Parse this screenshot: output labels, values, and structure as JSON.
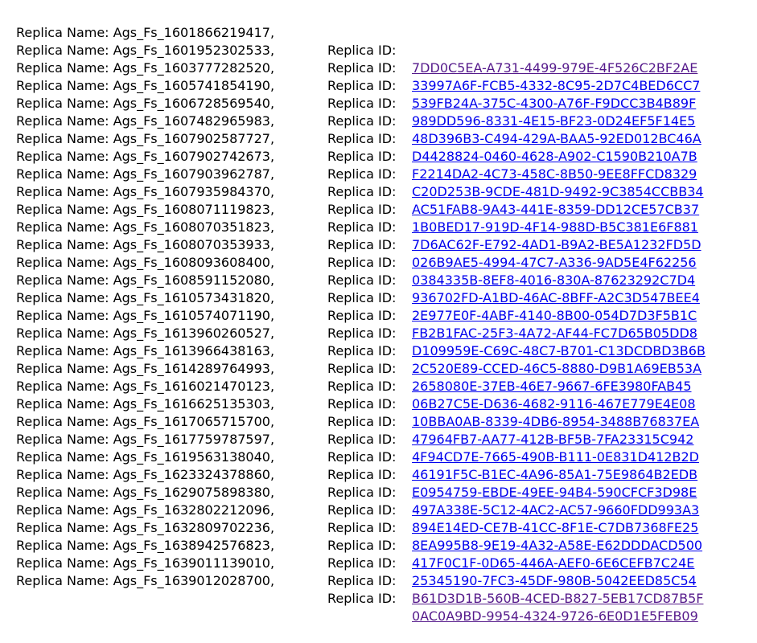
{
  "labels": {
    "name_prefix": "Replica Name: ",
    "id_prefix": "Replica ID: "
  },
  "colors": {
    "link": "#0000ee",
    "visited_link": "#551a8b",
    "text": "#000000"
  },
  "replicas": [
    {
      "name": "Ags_Fs_1601866219417,",
      "id": "7DD0C5EA-A731-4499-979E-4F526C2BF2AE",
      "visited": true
    },
    {
      "name": "Ags_Fs_1601952302533,",
      "id": "33997A6F-FCB5-4332-8C95-2D7C4BED6CC7",
      "visited": false
    },
    {
      "name": "Ags_Fs_1603777282520,",
      "id": "539FB24A-375C-4300-A76F-F9DCC3B4B89F",
      "visited": false
    },
    {
      "name": "Ags_Fs_1605741854190,",
      "id": "989DD596-8331-4E15-BF23-0D24EF5F14E5",
      "visited": false
    },
    {
      "name": "Ags_Fs_1606728569540,",
      "id": "48D396B3-C494-429A-BAA5-92ED012BC46A",
      "visited": false
    },
    {
      "name": "Ags_Fs_1607482965983,",
      "id": "D4428824-0460-4628-A902-C1590B210A7B",
      "visited": false
    },
    {
      "name": "Ags_Fs_1607902587727,",
      "id": "F2214DA2-4C73-458C-8B50-9EE8FFCD8329",
      "visited": false
    },
    {
      "name": "Ags_Fs_1607902742673,",
      "id": "C20D253B-9CDE-481D-9492-9C3854CCBB34",
      "visited": false
    },
    {
      "name": "Ags_Fs_1607903962787,",
      "id": "AC51FAB8-9A43-441E-8359-DD12CE57CB37",
      "visited": false
    },
    {
      "name": "Ags_Fs_1607935984370,",
      "id": "1B0BED17-919D-4F14-988D-B5C381E6F881",
      "visited": false
    },
    {
      "name": "Ags_Fs_1608071119823,",
      "id": "7D6AC62F-E792-4AD1-B9A2-BE5A1232FD5D",
      "visited": false
    },
    {
      "name": "Ags_Fs_1608070351823,",
      "id": "026B9AE5-4994-47C7-A336-9AD5E4F62256",
      "visited": false
    },
    {
      "name": "Ags_Fs_1608070353933,",
      "id": "0384335B-8EF8-4016-830A-87623292C7D4",
      "visited": false
    },
    {
      "name": "Ags_Fs_1608093608400,",
      "id": "936702FD-A1BD-46AC-8BFF-A2C3D547BEE4",
      "visited": false
    },
    {
      "name": "Ags_Fs_1608591152080,",
      "id": "2E977E0F-4ABF-4140-8B00-054D7D3F5B1C",
      "visited": false
    },
    {
      "name": "Ags_Fs_1610573431820,",
      "id": "FB2B1FAC-25F3-4A72-AF44-FC7D65B05DD8",
      "visited": false
    },
    {
      "name": "Ags_Fs_1610574071190,",
      "id": "D109959E-C69C-48C7-B701-C13DCDBD3B6B",
      "visited": false
    },
    {
      "name": "Ags_Fs_1613960260527,",
      "id": "2C520E89-CCED-46C5-8880-D9B1A69EB53A",
      "visited": false
    },
    {
      "name": "Ags_Fs_1613966438163,",
      "id": "2658080E-37EB-46E7-9667-6FE3980FAB45",
      "visited": false
    },
    {
      "name": "Ags_Fs_1614289764993,",
      "id": "06B27C5E-D636-4682-9116-467E779E4E08",
      "visited": false
    },
    {
      "name": "Ags_Fs_1616021470123,",
      "id": "10BBA0AB-8339-4DB6-8954-3488B76837EA",
      "visited": false
    },
    {
      "name": "Ags_Fs_1616625135303,",
      "id": "47964FB7-AA77-412B-BF5B-7FA23315C942",
      "visited": false
    },
    {
      "name": "Ags_Fs_1617065715700,",
      "id": "4F94CD7E-7665-490B-B111-0E831D412B2D",
      "visited": false
    },
    {
      "name": "Ags_Fs_1617759787597,",
      "id": "46191F5C-B1EC-4A96-85A1-75E9864B2EDB",
      "visited": false
    },
    {
      "name": "Ags_Fs_1619563138040,",
      "id": "E0954759-EBDE-49EE-94B4-590CFCF3D98E",
      "visited": false
    },
    {
      "name": "Ags_Fs_1623324378860,",
      "id": "497A338E-5C12-4AC2-AC57-9660FDD993A3",
      "visited": false
    },
    {
      "name": "Ags_Fs_1629075898380,",
      "id": "894E14ED-CE7B-41CC-8F1E-C7DB7368FE25",
      "visited": false
    },
    {
      "name": "Ags_Fs_1632802212096,",
      "id": "8EA995B8-9E19-4A32-A58E-E62DDDACD500",
      "visited": false
    },
    {
      "name": "Ags_Fs_1632809702236,",
      "id": "417F0C1F-0D65-446A-AEF0-6E6CEFB7C24E",
      "visited": false
    },
    {
      "name": "Ags_Fs_1638942576823,",
      "id": "25345190-7FC3-45DF-980B-5042EED85C54",
      "visited": false
    },
    {
      "name": "Ags_Fs_1639011139010,",
      "id": "B61D3D1B-560B-4CED-B827-5EB17CD87B5F",
      "visited": true
    },
    {
      "name": "Ags_Fs_1639012028700,",
      "id": "0AC0A9BD-9954-4324-9726-6E0D1E5FEB09",
      "visited": true
    }
  ]
}
